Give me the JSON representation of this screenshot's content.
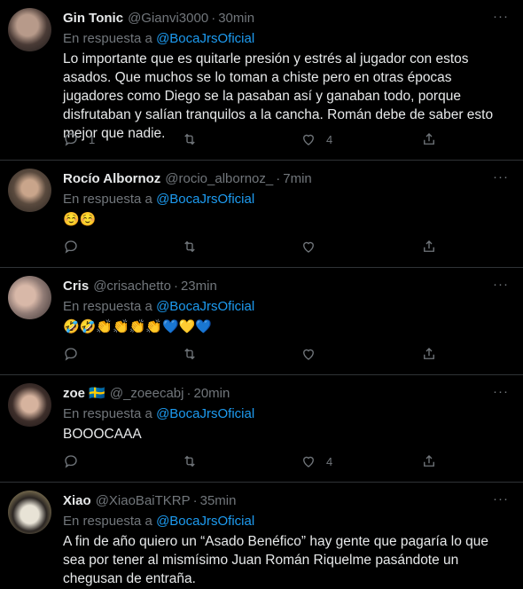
{
  "tweets": [
    {
      "name": "Gin Tonic",
      "handle": "@Gianvi3000",
      "sep": "·",
      "time": "30min",
      "reply_prefix": "En respuesta a",
      "reply_to": "@BocaJrsOficial",
      "text": "Lo importante que es quitarle presión y estrés al jugador con estos asados. Que muchos se lo toman a chiste pero en otras épocas jugadores como Diego se la pasaban así y ganaban todo, porque disfrutaban y salían tranquilos a la cancha. Román debe de saber esto mejor que nadie.",
      "replies": "1",
      "retweets": "",
      "likes": "4",
      "more": "···"
    },
    {
      "name": "Rocío Albornoz",
      "handle": "@rocio_albornoz_",
      "sep": "·",
      "time": "7min",
      "reply_prefix": "En respuesta a",
      "reply_to": "@BocaJrsOficial",
      "text": "☺️☺️",
      "replies": "",
      "retweets": "",
      "likes": "",
      "more": "···"
    },
    {
      "name": "Cris",
      "handle": "@crisachetto",
      "sep": "·",
      "time": "23min",
      "reply_prefix": "En respuesta a",
      "reply_to": "@BocaJrsOficial",
      "text": "🤣🤣👏👏👏👏💙💛💙",
      "replies": "",
      "retweets": "",
      "likes": "",
      "more": "···"
    },
    {
      "name": "zoe 🇸🇪",
      "handle": "@_zoeecabj",
      "sep": "·",
      "time": "20min",
      "reply_prefix": "En respuesta a",
      "reply_to": "@BocaJrsOficial",
      "text": "BOOOCAAA",
      "replies": "",
      "retweets": "",
      "likes": "4",
      "more": "···"
    },
    {
      "name": "Xiao",
      "handle": "@XiaoBaiTKRP",
      "sep": "·",
      "time": "35min",
      "reply_prefix": "En respuesta a",
      "reply_to": "@BocaJrsOficial",
      "text": "A fin de año quiero un “Asado Benéfico” hay gente que pagaría lo que sea por tener al mismísimo Juan Román Riquelme pasándote un chegusan de entraña.",
      "replies": "",
      "retweets": "",
      "likes": "",
      "more": "···"
    }
  ],
  "colors": {
    "background": "#000000",
    "name": "#e7e9ea",
    "muted": "#71767b",
    "mention": "#1d9bf0",
    "divider": "#2f3336"
  },
  "icons": [
    "reply-icon",
    "retweet-icon",
    "like-icon",
    "share-icon",
    "more-icon"
  ]
}
